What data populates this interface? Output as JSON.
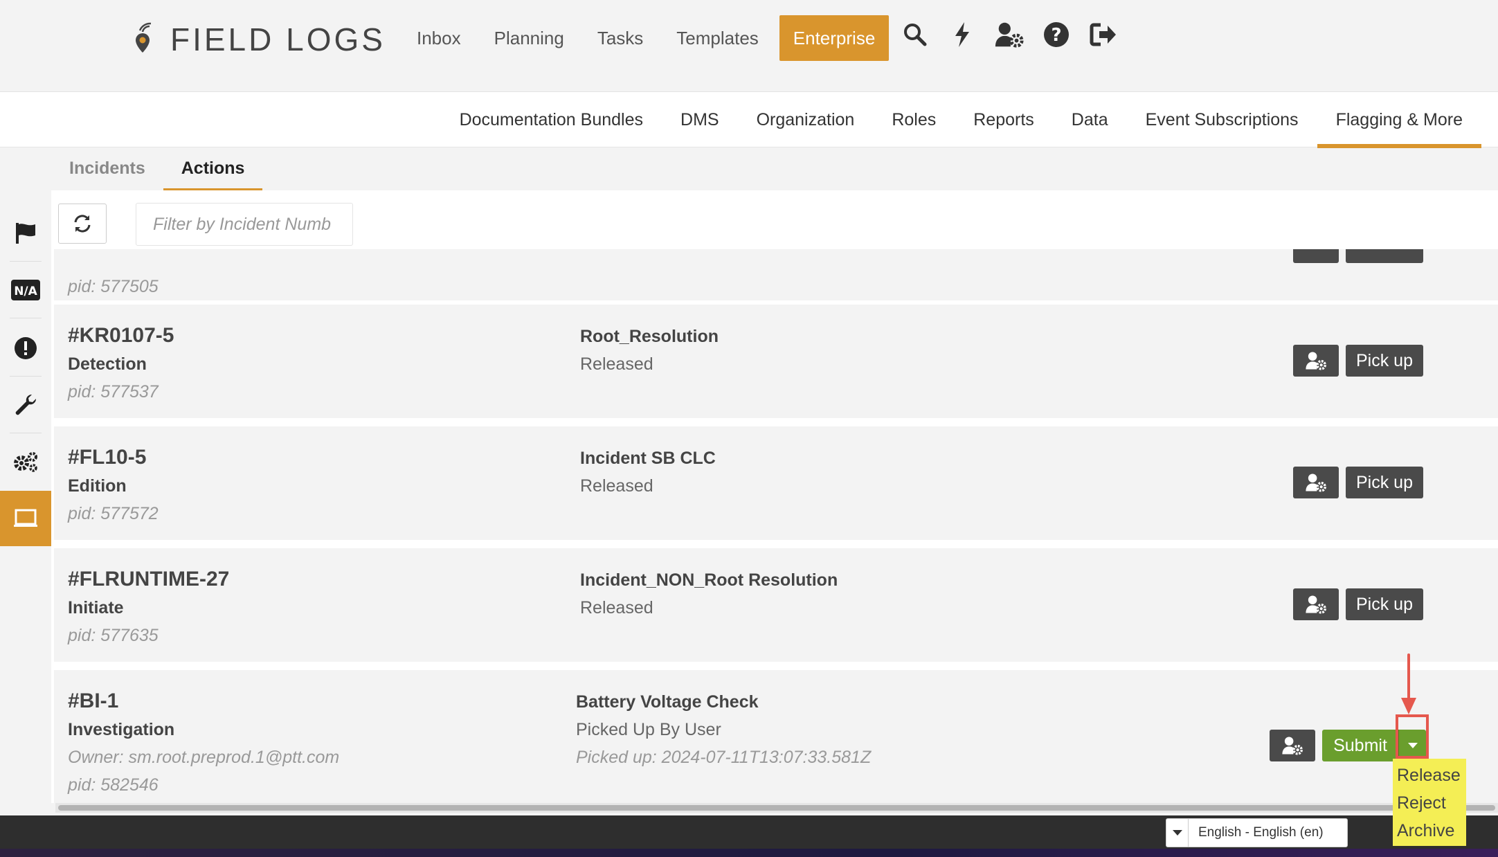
{
  "brand": {
    "name": "FIELD LOGS"
  },
  "top_nav": {
    "items": [
      "Inbox",
      "Planning",
      "Tasks",
      "Templates"
    ],
    "active": "Enterprise"
  },
  "sub_nav": {
    "items": [
      "Documentation Bundles",
      "DMS",
      "Organization",
      "Roles",
      "Reports",
      "Data",
      "Event Subscriptions",
      "Flagging & More"
    ],
    "active_index": 7
  },
  "tabs": {
    "incidents": "Incidents",
    "actions": "Actions"
  },
  "filter": {
    "placeholder": "Filter by Incident Numb"
  },
  "partial_row": {
    "pid": "pid: 577505"
  },
  "rows": [
    {
      "number": "#KR0107-5",
      "stage": "Detection",
      "pid": "pid: 577537",
      "action": "Root_Resolution",
      "status": "Released",
      "button": "Pick up"
    },
    {
      "number": "#FL10-5",
      "stage": "Edition",
      "pid": "pid: 577572",
      "action": "Incident SB CLC",
      "status": "Released",
      "button": "Pick up"
    },
    {
      "number": "#FLRUNTIME-27",
      "stage": "Initiate",
      "pid": "pid: 577635",
      "action": "Incident_NON_Root Resolution",
      "status": "Released",
      "button": "Pick up"
    }
  ],
  "last_row": {
    "number": "#BI-1",
    "stage": "Investigation",
    "owner": "Owner: sm.root.preprod.1@ptt.com",
    "pid": "pid: 582546",
    "action": "Battery Voltage Check",
    "status": "Picked Up By User",
    "picked": "Picked up: 2024-07-11T13:07:33.581Z",
    "button": "Submit"
  },
  "dropdown": {
    "items": [
      "Release",
      "Reject",
      "Archive"
    ]
  },
  "language": {
    "selected": "English - English (en)"
  },
  "colors": {
    "accent": "#d9952d",
    "submit": "#6a9e2d",
    "dark_button": "#4a4a4a",
    "highlight": "#e5584d",
    "menu": "#f4ee55"
  }
}
